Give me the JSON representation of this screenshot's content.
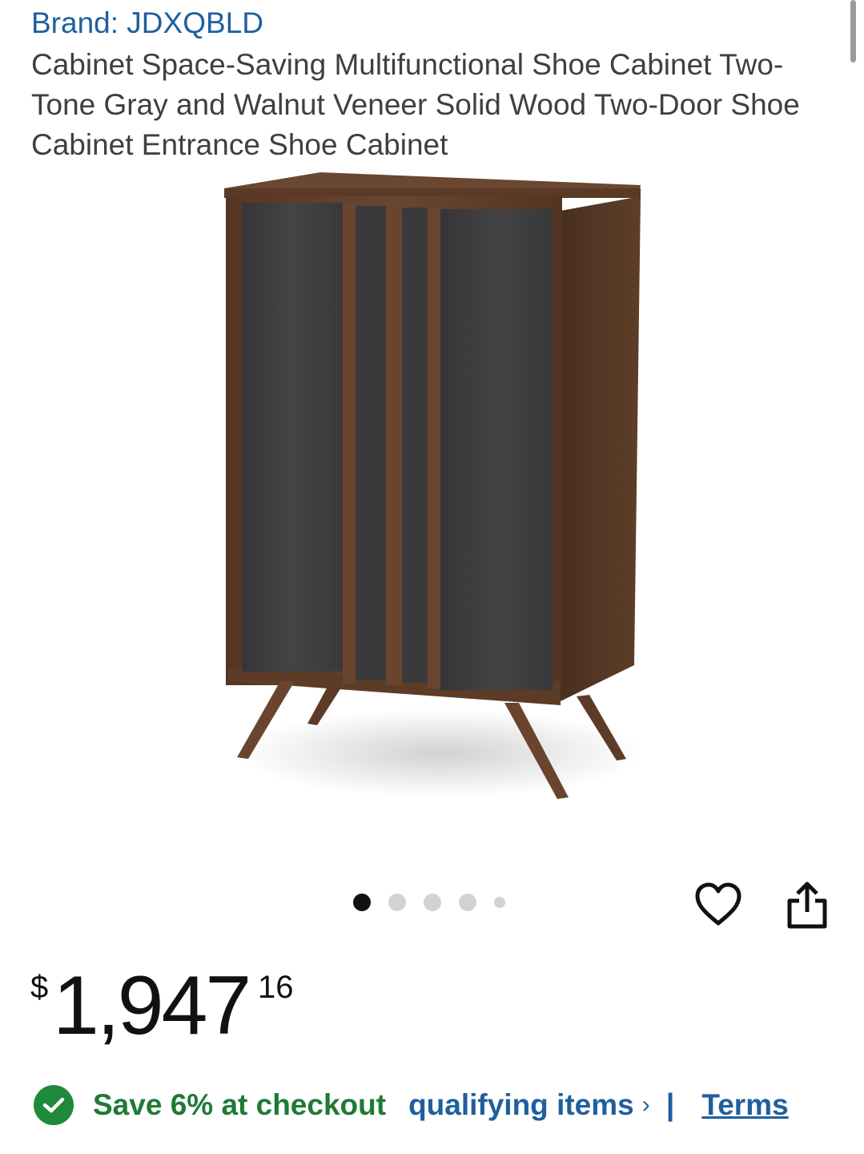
{
  "product": {
    "brand_label": "Brand: JDXQBLD",
    "title": "Cabinet Space-Saving Multifunctional Shoe Cabinet Two-Tone Gray and Walnut Veneer Solid Wood Two-Door Shoe Cabinet Entrance Shoe Cabinet"
  },
  "gallery": {
    "image_count": 5,
    "active_index": 0
  },
  "price": {
    "currency": "$",
    "whole": "1,947",
    "fraction": "16"
  },
  "promo": {
    "save_text": "Save 6% at checkout",
    "qualifying_text": "qualifying items",
    "chevron": "›",
    "separator": "|",
    "terms_text": "Terms"
  },
  "colors": {
    "link_blue": "#1f5f9e",
    "save_green": "#1f7a35",
    "walnut": "#5b3a26",
    "gray_panel": "#3d3d3f"
  },
  "icons": {
    "favorite": "heart-icon",
    "share": "share-icon",
    "promo": "check-circle-icon"
  }
}
